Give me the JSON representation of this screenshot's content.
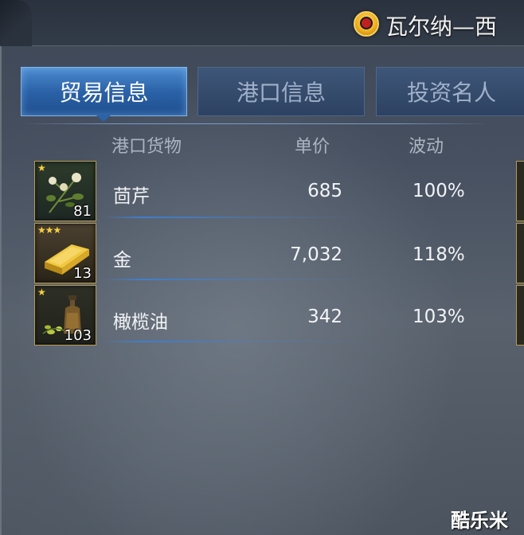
{
  "header": {
    "port_title": "瓦尔纳—西",
    "emblem_icon": "port-crest-icon"
  },
  "tabs": [
    {
      "label": "贸易信息",
      "active": true
    },
    {
      "label": "港口信息",
      "active": false
    },
    {
      "label": "投资名人",
      "active": false
    }
  ],
  "table": {
    "columns": [
      "港口货物",
      "单价",
      "波动"
    ],
    "rows": [
      {
        "icon": "herb-icon",
        "stars": "★",
        "count": "81",
        "name": "茴芹",
        "price": "685",
        "change": "100%"
      },
      {
        "icon": "gold-bar-icon",
        "stars": "★★★",
        "count": "13",
        "name": "金",
        "price": "7,032",
        "change": "118%"
      },
      {
        "icon": "olive-oil-icon",
        "stars": "★",
        "count": "103",
        "name": "橄榄油",
        "price": "342",
        "change": "103%"
      }
    ]
  },
  "watermark": "酷乐米",
  "colors": {
    "active_tab": "#2b62a8",
    "inactive_tab": "#2d4262",
    "tile_border": "#b89a4e",
    "star": "#f5d040"
  }
}
